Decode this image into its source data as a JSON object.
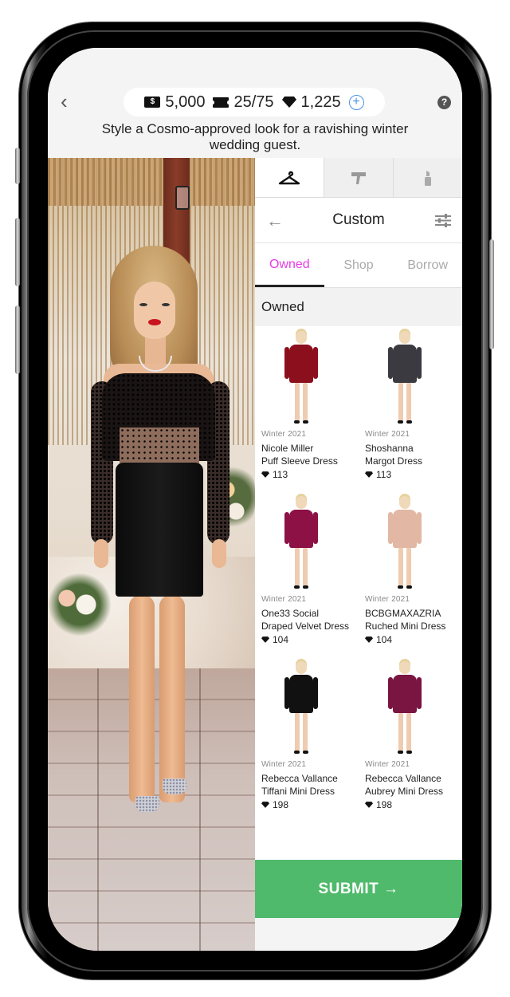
{
  "header": {
    "back_icon": "chevron-left-icon",
    "help_icon": "question-circle-icon",
    "currencies": [
      {
        "icon": "cash-icon",
        "value": "5,000"
      },
      {
        "icon": "ticket-icon",
        "value": "25/75"
      },
      {
        "icon": "diamond-icon",
        "value": "1,225"
      }
    ],
    "add_currency_icon": "plus-circle-icon",
    "prompt": "Style a Cosmo-approved look for a ravishing winter wedding guest."
  },
  "category_tabs": [
    {
      "icon": "hanger-icon",
      "active": true
    },
    {
      "icon": "hair-dryer-icon",
      "active": false
    },
    {
      "icon": "lipstick-icon",
      "active": false
    }
  ],
  "sub_header": {
    "back_icon": "arrow-left-icon",
    "title": "Custom",
    "filter_icon": "sliders-icon"
  },
  "source_tabs": [
    {
      "label": "Owned",
      "active": true
    },
    {
      "label": "Shop",
      "active": false
    },
    {
      "label": "Borrow",
      "active": false
    }
  ],
  "section_label": "Owned",
  "items": [
    {
      "season": "Winter 2021",
      "brand": "Nicole Miller",
      "name": "Puff Sleeve Dress",
      "price": "113",
      "color": "#8b0f1c"
    },
    {
      "season": "Winter 2021",
      "brand": "Shoshanna",
      "name": "Margot Dress",
      "price": "113",
      "color": "#3a3a40"
    },
    {
      "season": "Winter 2021",
      "brand": "One33 Social",
      "name": "Draped Velvet Dress",
      "price": "104",
      "color": "#8d1145"
    },
    {
      "season": "Winter 2021",
      "brand": "BCBGMAXAZRIA",
      "name": "Ruched Mini Dress",
      "price": "104",
      "color": "#e2b8a4"
    },
    {
      "season": "Winter 2021",
      "brand": "Rebecca Vallance",
      "name": "Tiffani Mini Dress",
      "price": "198",
      "color": "#111111"
    },
    {
      "season": "Winter 2021",
      "brand": "Rebecca Vallance",
      "name": "Aubrey Mini Dress",
      "price": "198",
      "color": "#7a1440"
    }
  ],
  "submit": {
    "label": "SUBMIT →"
  },
  "colors": {
    "accent_tab": "#e63be6",
    "submit_green": "#4fba6b",
    "plus_blue": "#4a90e2"
  }
}
